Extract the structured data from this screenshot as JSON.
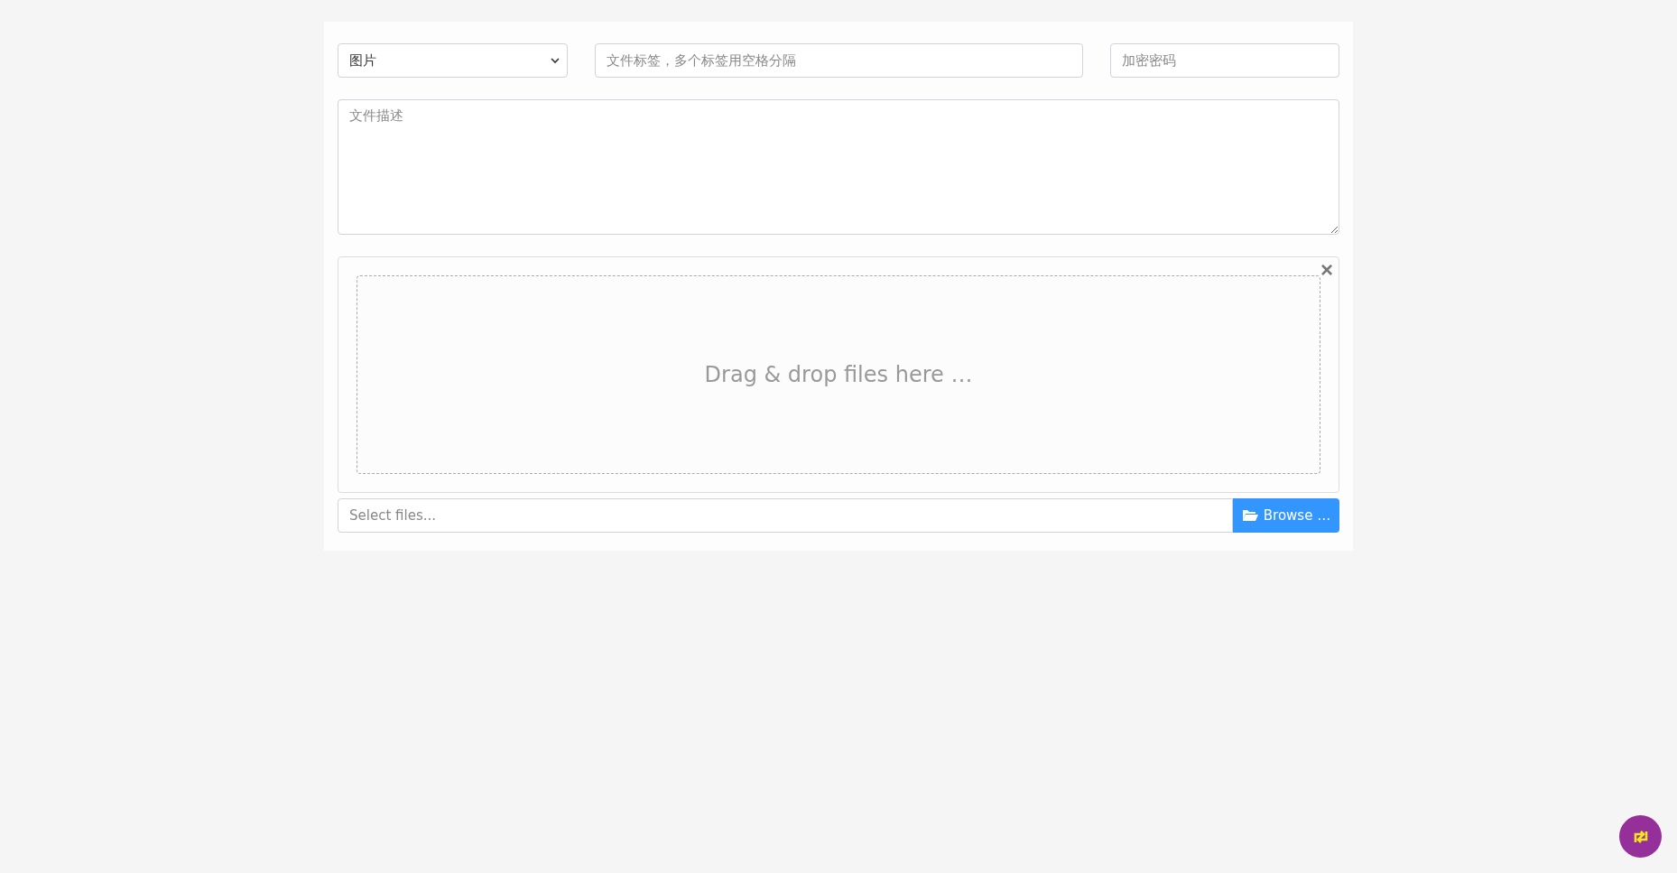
{
  "form": {
    "category_select": {
      "value": "图片"
    },
    "tags_field": {
      "placeholder": "文件标签，多个标签用空格分隔"
    },
    "password_field": {
      "placeholder": "加密密码"
    },
    "description_field": {
      "placeholder": "文件描述"
    }
  },
  "upload": {
    "drop_text": "Drag & drop files here …",
    "close_label": "×",
    "files_field": {
      "placeholder": "Select files..."
    },
    "browse_button": "Browse …"
  }
}
